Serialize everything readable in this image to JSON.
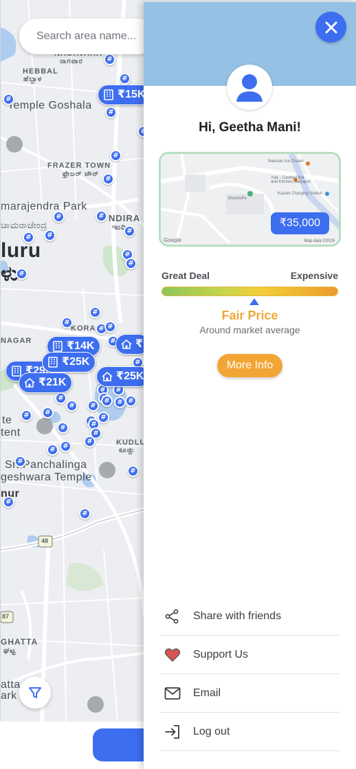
{
  "map": {
    "search_placeholder": "Search area name...",
    "labels": {
      "nagavara": "NAGAVARA",
      "nagavara_kn": "ನಾಗವಾರ",
      "hebbal": "HEBBAL",
      "hebbal_kn": "ಹೆಬ್ಬಾಳ",
      "temple_goshala": "Temple Goshala",
      "frazer_town": "FRAZER TOWN",
      "frazer_town_kn": "ಫ್ರೇಜರ್ ಟೌನ್",
      "ambedkar_park": "marajendra Park",
      "ambedkar_park_kn": "ಚಾಮರಾಜೇಂದ್ರ",
      "uru": "luru",
      "uru_kn": "ಳು",
      "indira": "NDIRA",
      "indira_kn": "ಇಂದಿರಾ",
      "kora": "KORA",
      "nagar": "NAGAR",
      "kudlu": "KUDLU",
      "kudlu_kn": "ಕೂಡ್ಲು",
      "panchalinga": "Sri Panchalinga",
      "nageshwara": "geshwara Temple",
      "nur": "nur",
      "nur_kn": "ರ್",
      "road_48": "48",
      "road_87": "87",
      "ghatta": "GHATTA",
      "ghatta_kn": "ಘಟ್ಟ",
      "atta": "atta",
      "park": "ark",
      "tent": "tent",
      "tee": "te"
    },
    "price_pins": [
      {
        "label": "₹15K",
        "kind": "building"
      },
      {
        "label": "₹14K",
        "kind": "building"
      },
      {
        "label": "₹25K",
        "kind": "building"
      },
      {
        "label": "₹29K",
        "kind": "building"
      },
      {
        "label": "₹21K",
        "kind": "home"
      },
      {
        "label": "₹25K",
        "kind": "home"
      },
      {
        "label": "₹",
        "kind": "home"
      }
    ],
    "pin_symbol": "#"
  },
  "drawer": {
    "greeting": "Hi, Geetha Mani!",
    "listing_price": "₹35,000",
    "thumb_labels": {
      "poi1": "Naturals Ice Cream",
      "poi2": "Yuki - Cocktail Bar and Kitchen, Sarjapur",
      "poi3": "Kazam Charging Station",
      "poi4": "ElectricPe",
      "google": "Google",
      "mapdata": "Map data ©2025"
    },
    "scale_left": "Great Deal",
    "scale_right": "Expensive",
    "verdict": "Fair Price",
    "verdict_sub": "Around market average",
    "more_info": "More Info",
    "menu": [
      {
        "label": "Share with friends",
        "icon": "share-icon"
      },
      {
        "label": "Support Us",
        "icon": "heart-icon"
      },
      {
        "label": "Email",
        "icon": "mail-icon"
      },
      {
        "label": "Log out",
        "icon": "logout-icon"
      }
    ]
  },
  "colors": {
    "accent": "#3d6ef0",
    "header": "#95c2e4",
    "fair_price": "#eca93a",
    "heart": "#d9534f"
  }
}
